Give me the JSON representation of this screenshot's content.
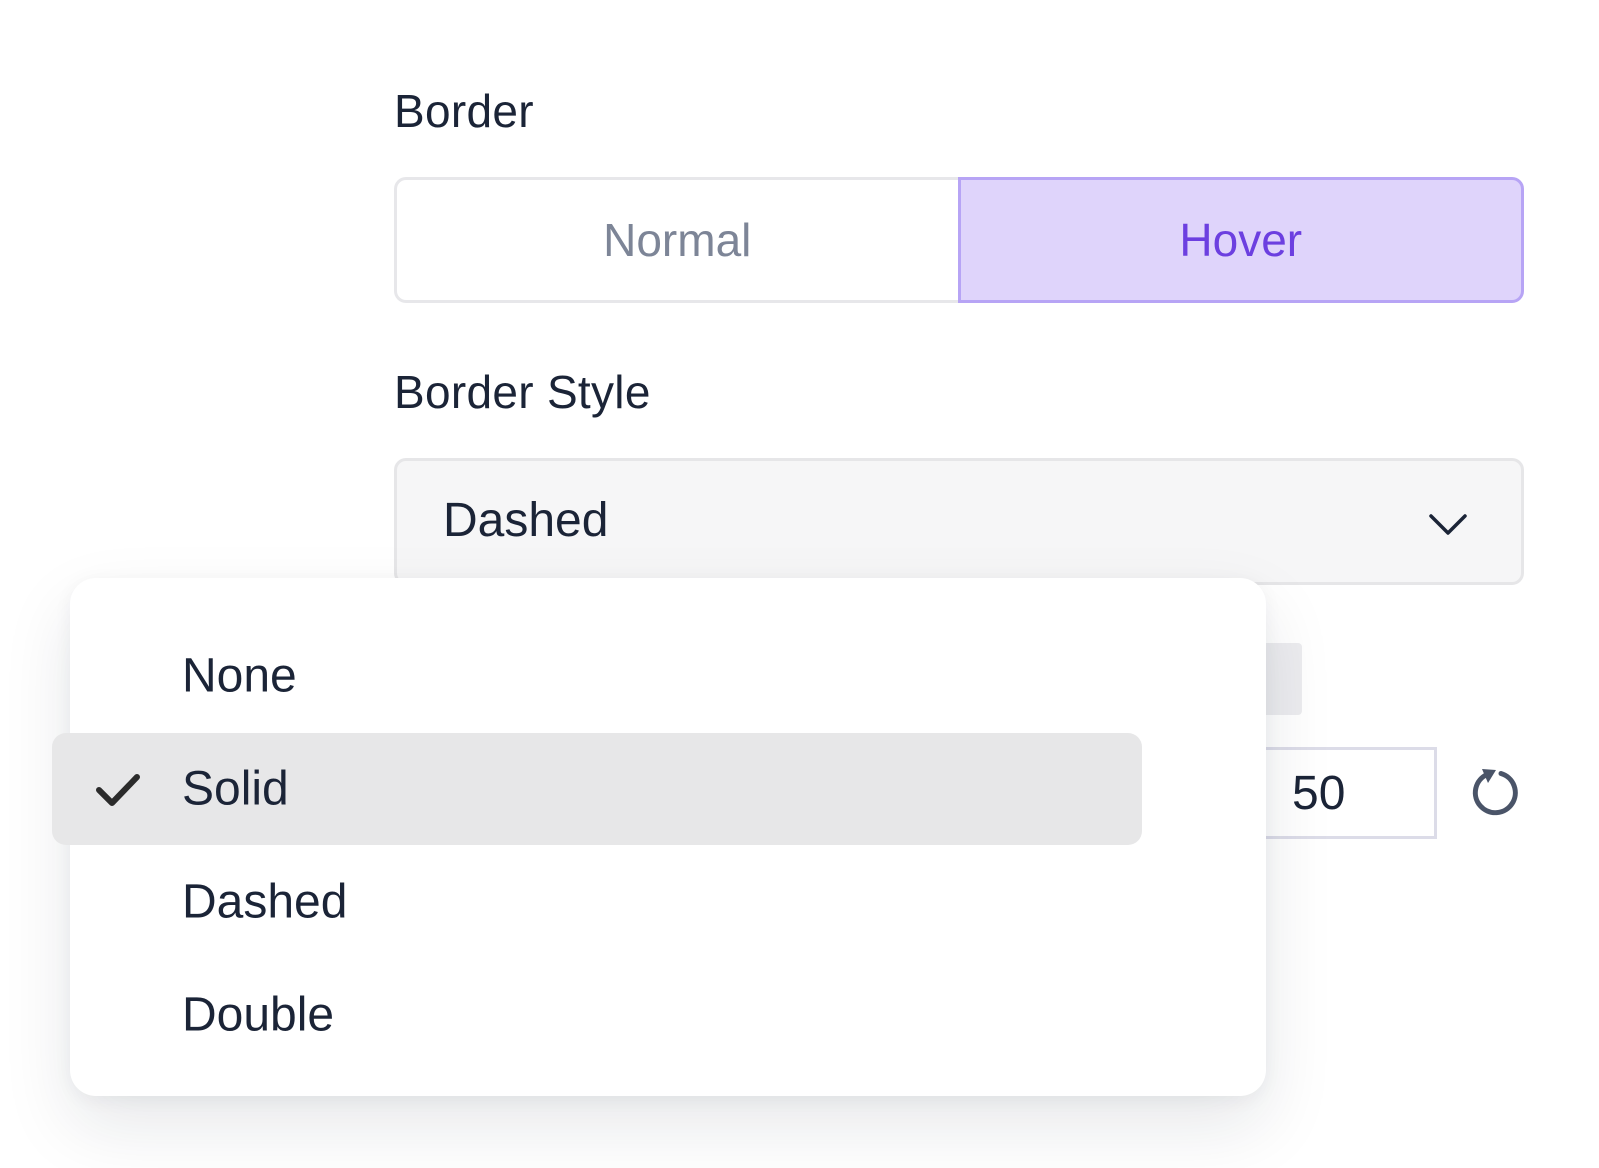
{
  "border": {
    "label": "Border",
    "states": [
      "Normal",
      "Hover"
    ],
    "active_state": "Hover"
  },
  "border_style": {
    "label": "Border Style",
    "selected_value": "Dashed",
    "options": [
      {
        "label": "None",
        "checked": false
      },
      {
        "label": "Solid",
        "checked": true
      },
      {
        "label": "Dashed",
        "checked": false
      },
      {
        "label": "Double",
        "checked": false
      }
    ]
  },
  "number_field": {
    "value": "50"
  },
  "icons": {
    "dropdown": "chevron-down-icon",
    "check": "check-icon",
    "reset": "reset-icon"
  },
  "colors": {
    "accent": "#6c3fe0",
    "active_bg": "#dfd4fb",
    "text": "#1b2437",
    "muted_text": "#7d8597",
    "highlight": "#e7e7e8"
  }
}
